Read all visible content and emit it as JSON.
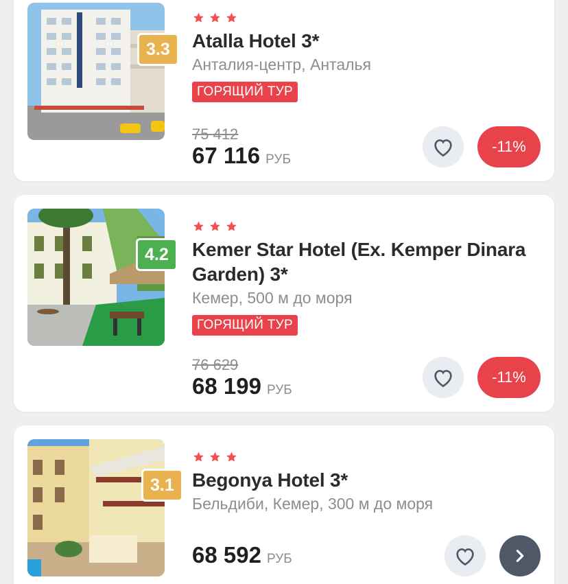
{
  "colors": {
    "accent_red": "#e8434b",
    "star": "#f0524f",
    "rating_yellow": "#e8b34f",
    "rating_green": "#4caf50",
    "fav_bg": "#e9edf2",
    "go_bg": "#4f5866"
  },
  "hotels": [
    {
      "stars": 3,
      "rating": "3.3",
      "rating_color": "#e8b34f",
      "name": "Atalla Hotel 3*",
      "location": "Анталия-центр, Анталья",
      "badge": "ГОРЯЩИЙ ТУР",
      "old_price": "75 412",
      "price": "67 116",
      "currency": "РУБ",
      "discount": "-11%",
      "favorite_icon": "heart-outline-icon"
    },
    {
      "stars": 3,
      "rating": "4.2",
      "rating_color": "#4caf50",
      "name": "Kemer Star Hotel (Ex. Kemper Dinara Garden) 3*",
      "location": "Кемер, 500 м до моря",
      "badge": "ГОРЯЩИЙ ТУР",
      "old_price": "76 629",
      "price": "68 199",
      "currency": "РУБ",
      "discount": "-11%",
      "favorite_icon": "heart-outline-icon"
    },
    {
      "stars": 3,
      "rating": "3.1",
      "rating_color": "#e8b34f",
      "name": "Begonya Hotel 3*",
      "location": "Бельдиби, Кемер, 300 м до моря",
      "price": "68 592",
      "currency": "РУБ",
      "favorite_icon": "heart-outline-icon",
      "action_icon": "chevron-right-icon"
    }
  ]
}
